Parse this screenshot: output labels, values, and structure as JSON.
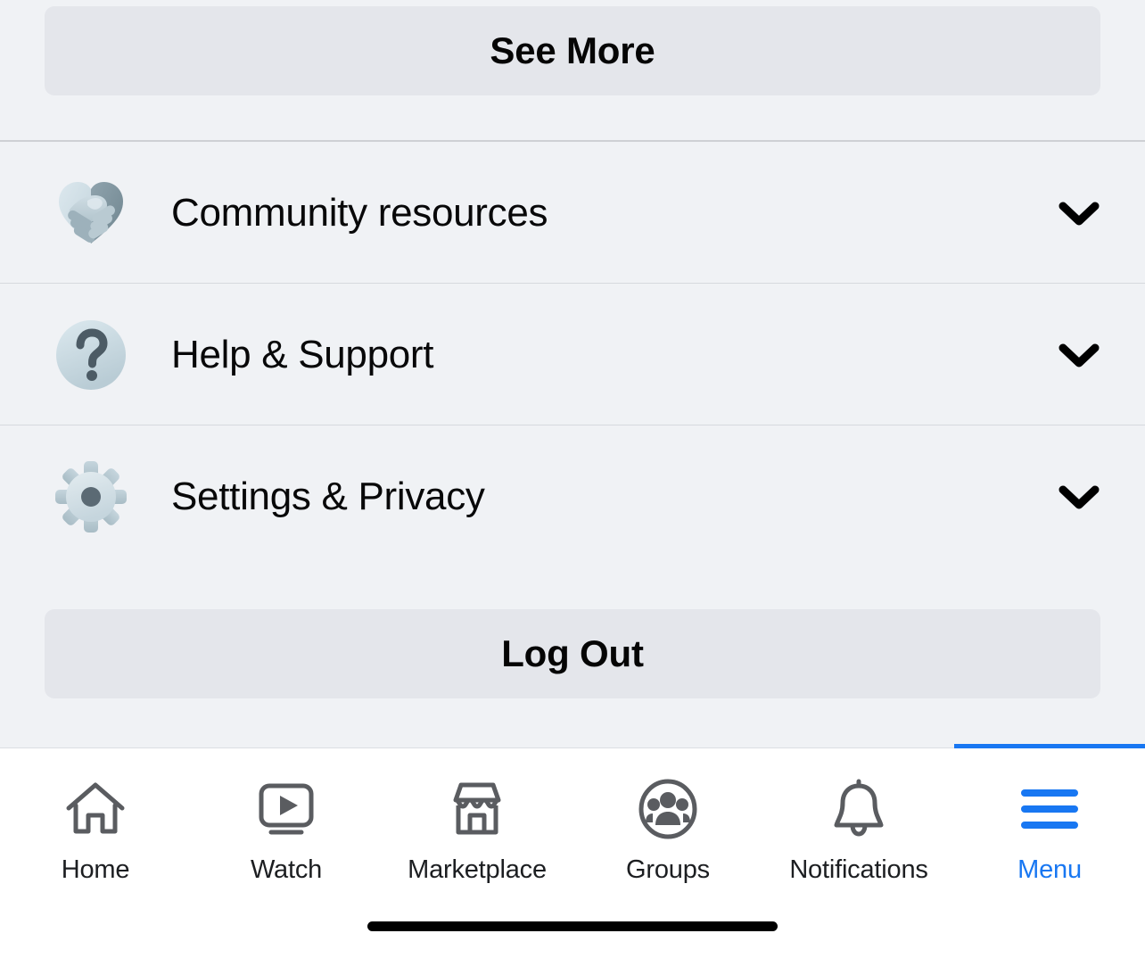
{
  "buttons": {
    "see_more": "See More",
    "log_out": "Log Out"
  },
  "menu_rows": [
    {
      "label": "Community resources",
      "icon": "handshake-heart-icon",
      "chevron": "chevron-down-icon"
    },
    {
      "label": "Help & Support",
      "icon": "question-mark-circle-icon",
      "chevron": "chevron-down-icon"
    },
    {
      "label": "Settings & Privacy",
      "icon": "gear-icon",
      "chevron": "chevron-down-icon"
    }
  ],
  "tabbar": {
    "active_index": 5,
    "items": [
      {
        "label": "Home",
        "icon": "home-icon"
      },
      {
        "label": "Watch",
        "icon": "video-play-icon"
      },
      {
        "label": "Marketplace",
        "icon": "storefront-icon"
      },
      {
        "label": "Groups",
        "icon": "people-circle-icon"
      },
      {
        "label": "Notifications",
        "icon": "bell-icon"
      },
      {
        "label": "Menu",
        "icon": "hamburger-icon"
      }
    ]
  },
  "colors": {
    "page_background": "#f0f2f5",
    "button_background": "#e4e6eb",
    "primary_text": "#050505",
    "accent_blue": "#1877f2",
    "tab_icon_gray": "#5a5c60",
    "divider": "#d6d9de"
  }
}
